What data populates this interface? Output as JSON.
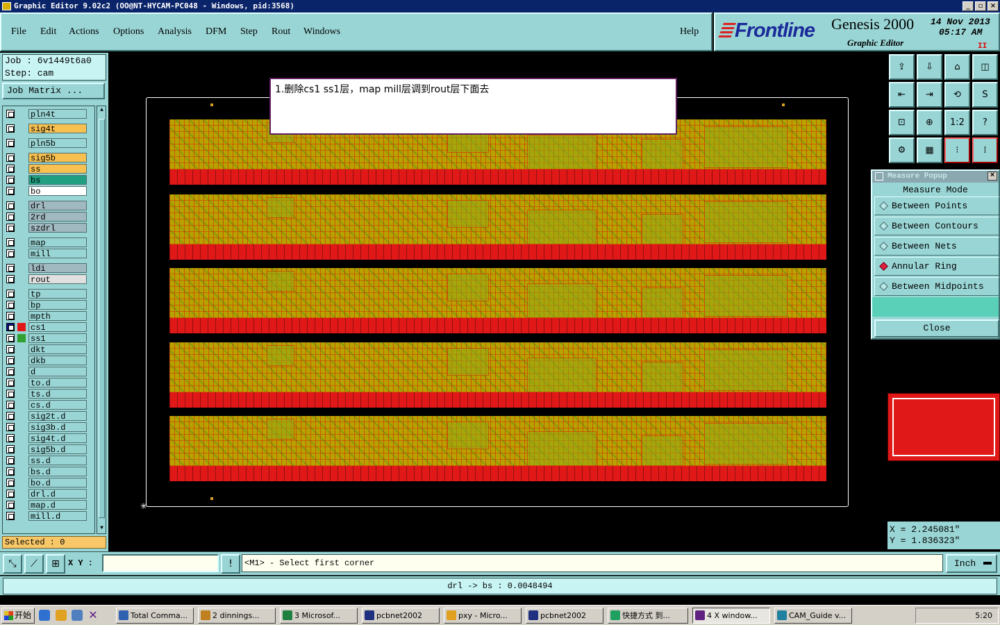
{
  "window": {
    "title": "Graphic Editor 9.02c2 (OO@NT-HYCAM-PC048 - Windows, pid:3568)"
  },
  "menu": {
    "items": [
      "File",
      "Edit",
      "Actions",
      "Options",
      "Analysis",
      "DFM",
      "Step",
      "Rout",
      "Windows"
    ],
    "help": "Help"
  },
  "brand": {
    "logo": "Frontline",
    "product": "Genesis 2000",
    "subtitle": "Graphic Editor",
    "date": "14 Nov 2013",
    "time": "05:17 AM",
    "pause": "II"
  },
  "job": {
    "job_line": "Job : 6v1449t6a0",
    "step_line": "Step: cam",
    "matrix_button": "Job Matrix ..."
  },
  "layers": [
    {
      "name": "pln4t",
      "color": "#9ad5d5"
    },
    {
      "name": "sig4t",
      "color": "#f8c050"
    },
    {
      "name": "pln5b",
      "color": "#9ad5d5"
    },
    {
      "name": "sig5b",
      "color": "#f8c050"
    },
    {
      "name": "ss",
      "color": "#f8c050"
    },
    {
      "name": "bs",
      "color": "#20a080"
    },
    {
      "name": "bo",
      "color": "#ffffff"
    },
    {
      "name": "drl",
      "color": "#a0b8c0"
    },
    {
      "name": "2rd",
      "color": "#a0b8c0"
    },
    {
      "name": "szdrl",
      "color": "#a0b8c0"
    },
    {
      "name": "map",
      "color": "#9ad5d5"
    },
    {
      "name": "mill",
      "color": "#9ad5d5"
    },
    {
      "name": "ldi",
      "color": "#a0b8c0"
    },
    {
      "name": "rout",
      "color": "#e0e0e0"
    },
    {
      "name": "tp",
      "color": "#9ad5d5"
    },
    {
      "name": "bp",
      "color": "#9ad5d5"
    },
    {
      "name": "mpth",
      "color": "#9ad5d5"
    },
    {
      "name": "cs1",
      "color": "#9ad5d5"
    },
    {
      "name": "ss1",
      "color": "#9ad5d5"
    },
    {
      "name": "dkt",
      "color": "#9ad5d5"
    },
    {
      "name": "dkb",
      "color": "#9ad5d5"
    },
    {
      "name": "d",
      "color": "#9ad5d5"
    },
    {
      "name": "to.d",
      "color": "#9ad5d5"
    },
    {
      "name": "ts.d",
      "color": "#9ad5d5"
    },
    {
      "name": "cs.d",
      "color": "#9ad5d5"
    },
    {
      "name": "sig2t.d",
      "color": "#9ad5d5"
    },
    {
      "name": "sig3b.d",
      "color": "#9ad5d5"
    },
    {
      "name": "sig4t.d",
      "color": "#9ad5d5"
    },
    {
      "name": "sig5b.d",
      "color": "#9ad5d5"
    },
    {
      "name": "ss.d",
      "color": "#9ad5d5"
    },
    {
      "name": "bs.d",
      "color": "#9ad5d5"
    },
    {
      "name": "bo.d",
      "color": "#9ad5d5"
    },
    {
      "name": "drl.d",
      "color": "#9ad5d5"
    },
    {
      "name": "map.d",
      "color": "#9ad5d5"
    },
    {
      "name": "mill.d",
      "color": "#9ad5d5"
    }
  ],
  "selected": "Selected : 0",
  "note": "1.删除cs1 ss1层，map mill层调到rout层下面去",
  "measure": {
    "title": "Measure Popup",
    "heading": "Measure Mode",
    "options": [
      "Between Points",
      "Between Contours",
      "Between Nets",
      "Annular Ring",
      "Between Midpoints"
    ],
    "active_option": "Annular Ring",
    "close": "Close"
  },
  "coords": {
    "x": "X = 2.245081\"",
    "y": "Y = 1.836323\""
  },
  "input": {
    "label": "X Y :",
    "value": ""
  },
  "prompt": "<M1> - Select first corner",
  "unit": "Inch",
  "status": "drl -> bs : 0.0048494",
  "taskbar": {
    "start": "开始",
    "tasks": [
      "Total Comma...",
      "2 dinnings...",
      "3 Microsof...",
      "pcbnet2002",
      "pxy - Micro...",
      "pcbnet2002",
      "快捷方式 到...",
      "4 X window...",
      "CAM_Guide v..."
    ],
    "clock": "5:20"
  }
}
